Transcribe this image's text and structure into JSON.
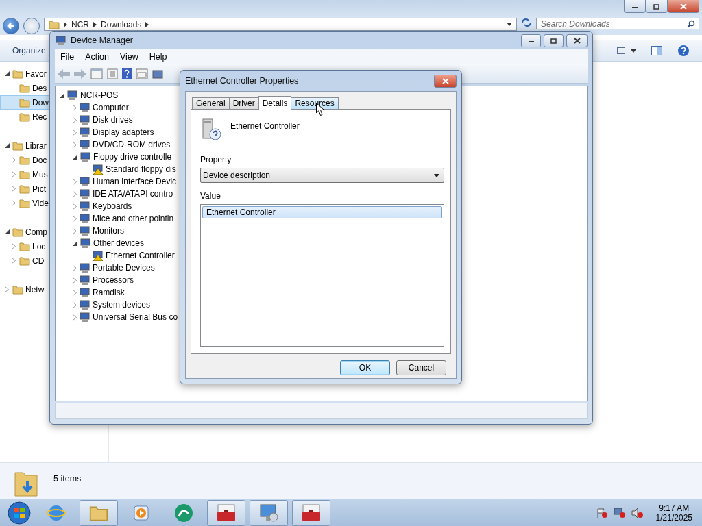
{
  "explorer": {
    "breadcrumb": [
      "NCR",
      "Downloads"
    ],
    "search": {
      "placeholder": "Search Downloads"
    },
    "toolbar": {
      "organize": "Organize"
    },
    "nav": [
      {
        "label": "Favor",
        "expanded": true,
        "selected": false,
        "children": [
          {
            "label": "Des",
            "selected": false
          },
          {
            "label": "Dow",
            "selected": true
          },
          {
            "label": "Rec",
            "selected": false
          }
        ]
      },
      {
        "label": "Librar",
        "expanded": true,
        "selected": false,
        "children": [
          {
            "label": "Doc",
            "expanded": false,
            "selected": false
          },
          {
            "label": "Mus",
            "expanded": false,
            "selected": false
          },
          {
            "label": "Pict",
            "expanded": false,
            "selected": false
          },
          {
            "label": "Vide",
            "expanded": false,
            "selected": false
          }
        ]
      },
      {
        "label": "Comp",
        "expanded": true,
        "selected": false,
        "children": [
          {
            "label": "Loc",
            "expanded": false,
            "selected": false
          },
          {
            "label": "CD",
            "expanded": false,
            "selected": false
          }
        ]
      },
      {
        "label": "Netw",
        "expanded": false,
        "selected": false
      }
    ],
    "status": "5 items"
  },
  "device_manager": {
    "title": "Device Manager",
    "menu": [
      "File",
      "Action",
      "View",
      "Help"
    ],
    "tree": {
      "label": "NCR-POS",
      "expanded": true,
      "children": [
        {
          "label": "Computer",
          "expanded": false,
          "warning": false
        },
        {
          "label": "Disk drives",
          "expanded": false,
          "warning": false
        },
        {
          "label": "Display adapters",
          "expanded": false,
          "warning": false
        },
        {
          "label": "DVD/CD-ROM drives",
          "expanded": false,
          "warning": false
        },
        {
          "label": "Floppy drive controlle",
          "expanded": true,
          "warning": false,
          "children": [
            {
              "label": "Standard floppy dis",
              "warning": true
            }
          ]
        },
        {
          "label": "Human Interface Devic",
          "expanded": false,
          "warning": false
        },
        {
          "label": "IDE ATA/ATAPI contro",
          "expanded": false,
          "warning": false
        },
        {
          "label": "Keyboards",
          "expanded": false,
          "warning": false
        },
        {
          "label": "Mice and other pointin",
          "expanded": false,
          "warning": false
        },
        {
          "label": "Monitors",
          "expanded": false,
          "warning": false
        },
        {
          "label": "Other devices",
          "expanded": true,
          "warning": false,
          "children": [
            {
              "label": "Ethernet Controller",
              "warning": true
            }
          ]
        },
        {
          "label": "Portable Devices",
          "expanded": false,
          "warning": false
        },
        {
          "label": "Processors",
          "expanded": false,
          "warning": false
        },
        {
          "label": "Ramdisk",
          "expanded": false,
          "warning": false
        },
        {
          "label": "System devices",
          "expanded": false,
          "warning": false
        },
        {
          "label": "Universal Serial Bus co",
          "expanded": false,
          "warning": false
        }
      ]
    }
  },
  "dialog": {
    "title": "Ethernet Controller Properties",
    "tabs": [
      {
        "label": "General",
        "selected": false,
        "hovered": false
      },
      {
        "label": "Driver",
        "selected": false,
        "hovered": false
      },
      {
        "label": "Details",
        "selected": true,
        "hovered": false
      },
      {
        "label": "Resources",
        "selected": false,
        "hovered": true
      }
    ],
    "device_name": "Ethernet Controller",
    "property_label": "Property",
    "property_select": "Device description",
    "value_label": "Value",
    "values": [
      {
        "text": "Ethernet Controller",
        "selected": true
      }
    ],
    "buttons": [
      {
        "label": "OK",
        "default": true
      },
      {
        "label": "Cancel",
        "default": false
      }
    ]
  },
  "taskbar": {
    "buttons": [
      {
        "kind": "browser",
        "running": false
      },
      {
        "kind": "folder",
        "running": true
      },
      {
        "kind": "media",
        "running": false
      },
      {
        "kind": "app",
        "running": false
      },
      {
        "kind": "toolbox",
        "running": true
      },
      {
        "kind": "monitor",
        "running": true
      },
      {
        "kind": "toolbox",
        "running": true
      }
    ],
    "clock": {
      "time": "9:17 AM",
      "date": "1/21/2025"
    }
  }
}
